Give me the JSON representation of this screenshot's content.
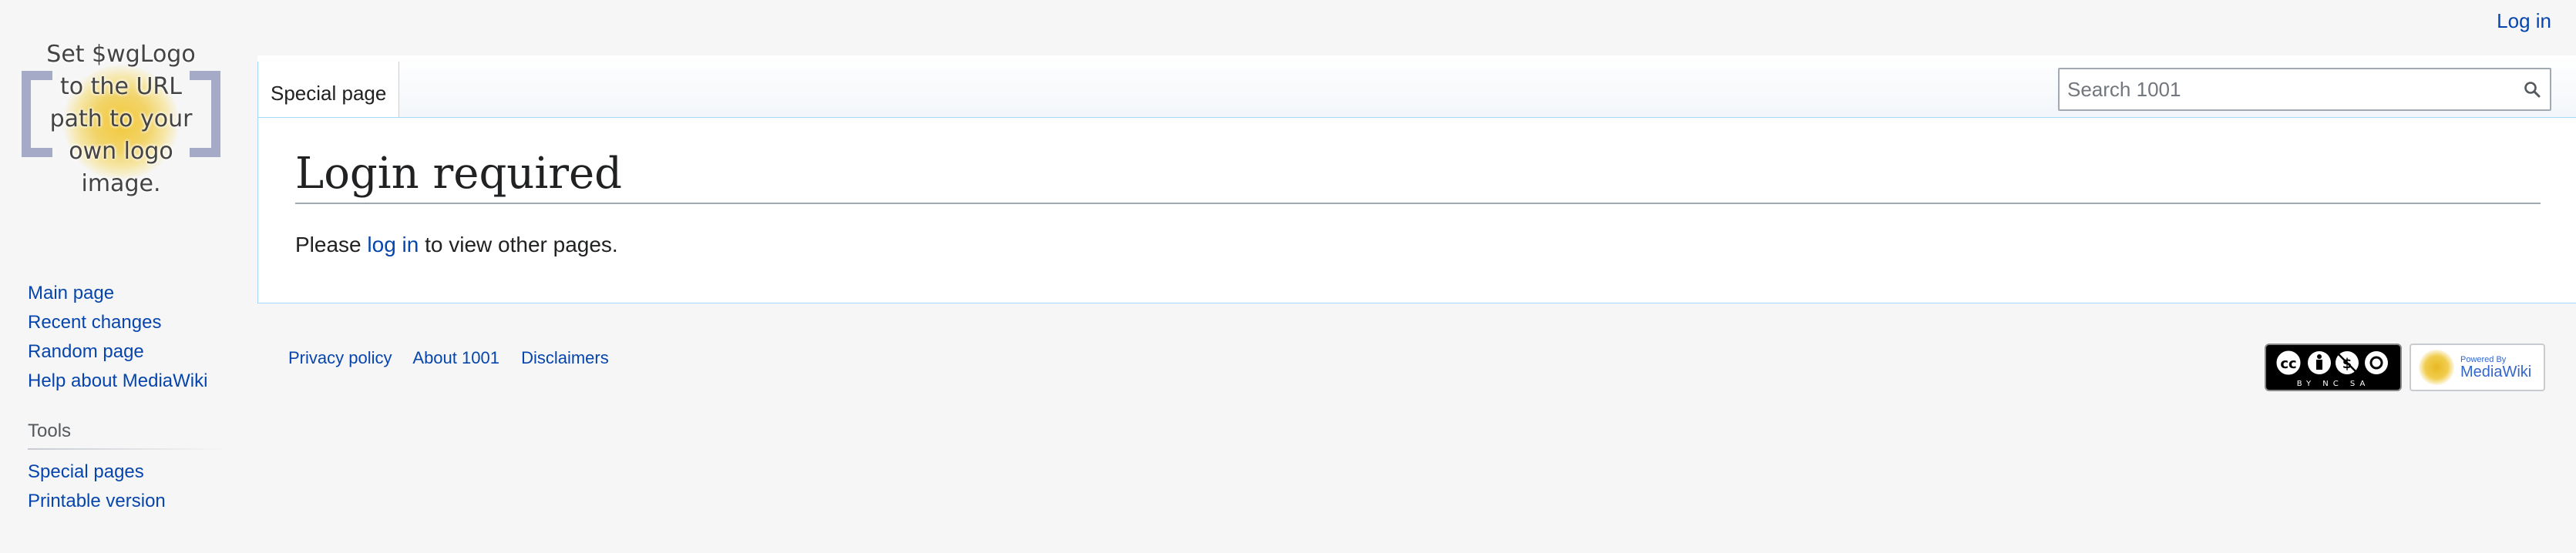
{
  "personal": {
    "login_label": "Log in"
  },
  "logo": {
    "text_lines": [
      "Set $wgLogo",
      "to the URL",
      "path to your",
      "own logo",
      "image."
    ]
  },
  "tabs": [
    {
      "label": "Special page"
    }
  ],
  "search": {
    "placeholder": "Search 1001",
    "value": ""
  },
  "content": {
    "title": "Login required",
    "body_prefix": "Please ",
    "body_link": "log in",
    "body_suffix": " to view other pages."
  },
  "sidebar": {
    "navigation": [
      {
        "label": "Main page"
      },
      {
        "label": "Recent changes"
      },
      {
        "label": "Random page"
      },
      {
        "label": "Help about MediaWiki"
      }
    ],
    "tools_heading": "Tools",
    "tools": [
      {
        "label": "Special pages"
      },
      {
        "label": "Printable version"
      }
    ]
  },
  "footer": {
    "links": [
      {
        "label": "Privacy policy"
      },
      {
        "label": "About 1001"
      },
      {
        "label": "Disclaimers"
      }
    ],
    "cc_label": "BY NC SA",
    "powered_small": "Powered By",
    "powered_big": "MediaWiki"
  },
  "colors": {
    "link": "#0645ad",
    "border": "#a7d7f9",
    "background": "#f6f6f6"
  }
}
